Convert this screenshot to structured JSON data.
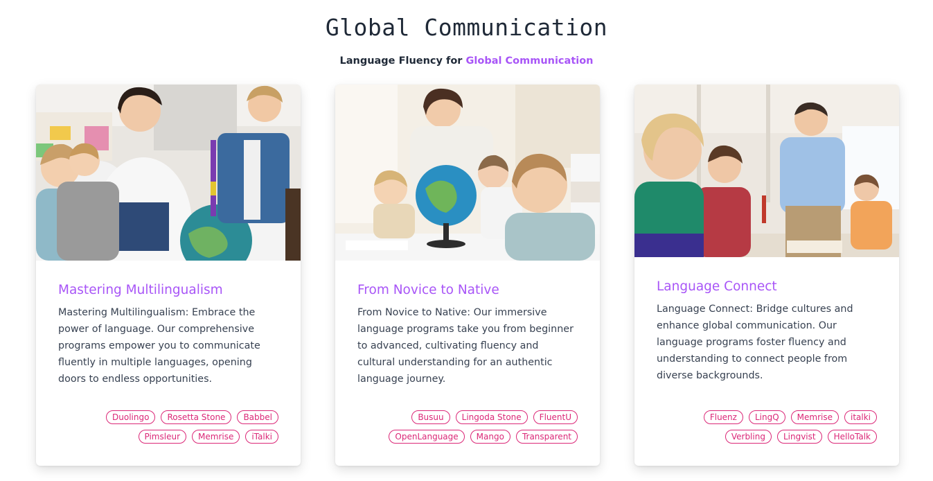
{
  "page": {
    "title": "Global Communication",
    "subtitle_prefix": "Language Fluency for ",
    "subtitle_accent": "Global Communication"
  },
  "colors": {
    "accent": "#a855f7",
    "tag": "#db2777",
    "text": "#374151"
  },
  "cards": [
    {
      "image": "teacher-with-children-and-globe-photo",
      "title": "Mastering Multilingualism",
      "text": "Mastering Multilingualism: Embrace the power of language. Our comprehensive programs empower you to communicate fluently in multiple languages, opening doors to endless opportunities.",
      "tags": [
        "Duolingo",
        "Rosetta Stone",
        "Babbel",
        "Pimsleur",
        "Memrise",
        "iTalki"
      ]
    },
    {
      "image": "teacher-showing-globe-to-kids-photo",
      "title": "From Novice to Native",
      "text": "From Novice to Native: Our immersive language programs take you from beginner to advanced, cultivating fluency and cultural understanding for an authentic language journey.",
      "tags": [
        "Busuu",
        "Lingoda Stone",
        "FluentU",
        "OpenLanguage",
        "Mango",
        "Transparent"
      ]
    },
    {
      "image": "teacher-in-classroom-with-students-photo",
      "title": "Language Connect",
      "text": "Language Connect: Bridge cultures and enhance global communication. Our language programs foster fluency and understanding to connect people from diverse backgrounds.",
      "tags": [
        "Fluenz",
        "LingQ",
        "Memrise",
        "italki",
        "Verbling",
        "Lingvist",
        "HelloTalk"
      ]
    }
  ]
}
